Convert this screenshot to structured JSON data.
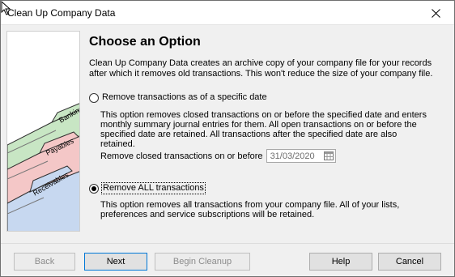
{
  "window": {
    "title": "Clean Up Company Data"
  },
  "content": {
    "heading": "Choose an Option",
    "intro": "Clean Up Company Data creates an archive copy of your company file for your records after which it removes old transactions. This won't reduce the size of your company file."
  },
  "options": [
    {
      "label": "Remove transactions as of a specific date",
      "checked": false,
      "description": "This option removes closed transactions on or before the specified date and enters monthly summary journal entries for them.  All open transactions on or before the specified date are retained.  All transactions after the specified date are also retained.",
      "date_label": "Remove closed transactions on or before",
      "date_value": "31/03/2020"
    },
    {
      "label": "Remove ALL transactions",
      "checked": true,
      "description": "This option removes all transactions from your company file.  All of your lists, preferences and service subscriptions will be retained."
    }
  ],
  "illustration": {
    "tabs": [
      "Banking",
      "Payables",
      "Receivables"
    ]
  },
  "buttons": {
    "back": "Back",
    "next": "Next",
    "begin_cleanup": "Begin Cleanup",
    "help": "Help",
    "cancel": "Cancel"
  },
  "colors": {
    "banking_folder": "#c8e6c4",
    "payables_folder": "#f4c7c7",
    "receivables_folder": "#c7d8f0",
    "default_button_border": "#0078d7"
  }
}
